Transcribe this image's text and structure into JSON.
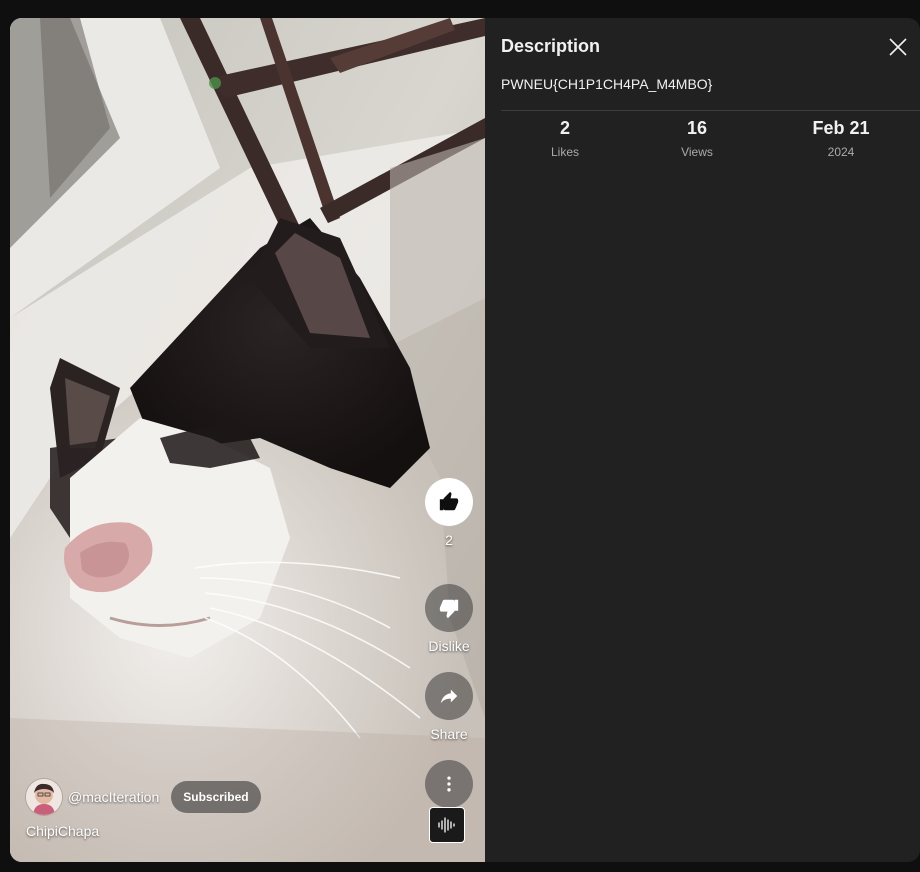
{
  "video": {
    "channel_handle": "@macIteration",
    "subscribe_label": "Subscribed",
    "title": "ChipiChapa"
  },
  "actions": {
    "like_count": "2",
    "dislike_label": "Dislike",
    "share_label": "Share"
  },
  "description_panel": {
    "heading": "Description",
    "text": "PWNEU{CH1P1CH4PA_M4MBO}",
    "stats": [
      {
        "value": "2",
        "label": "Likes"
      },
      {
        "value": "16",
        "label": "Views"
      },
      {
        "value": "Feb 21",
        "label": "2024"
      }
    ]
  },
  "icons": {
    "close": "close-icon",
    "like": "thumbs-up-icon",
    "dislike": "thumbs-down-icon",
    "share": "share-arrow-icon",
    "more": "more-vert-icon",
    "sound": "sound-wave-icon"
  },
  "colors": {
    "panel_bg": "#212121",
    "page_bg": "#0f0f0f",
    "secondary_text": "#aaaaaa"
  }
}
